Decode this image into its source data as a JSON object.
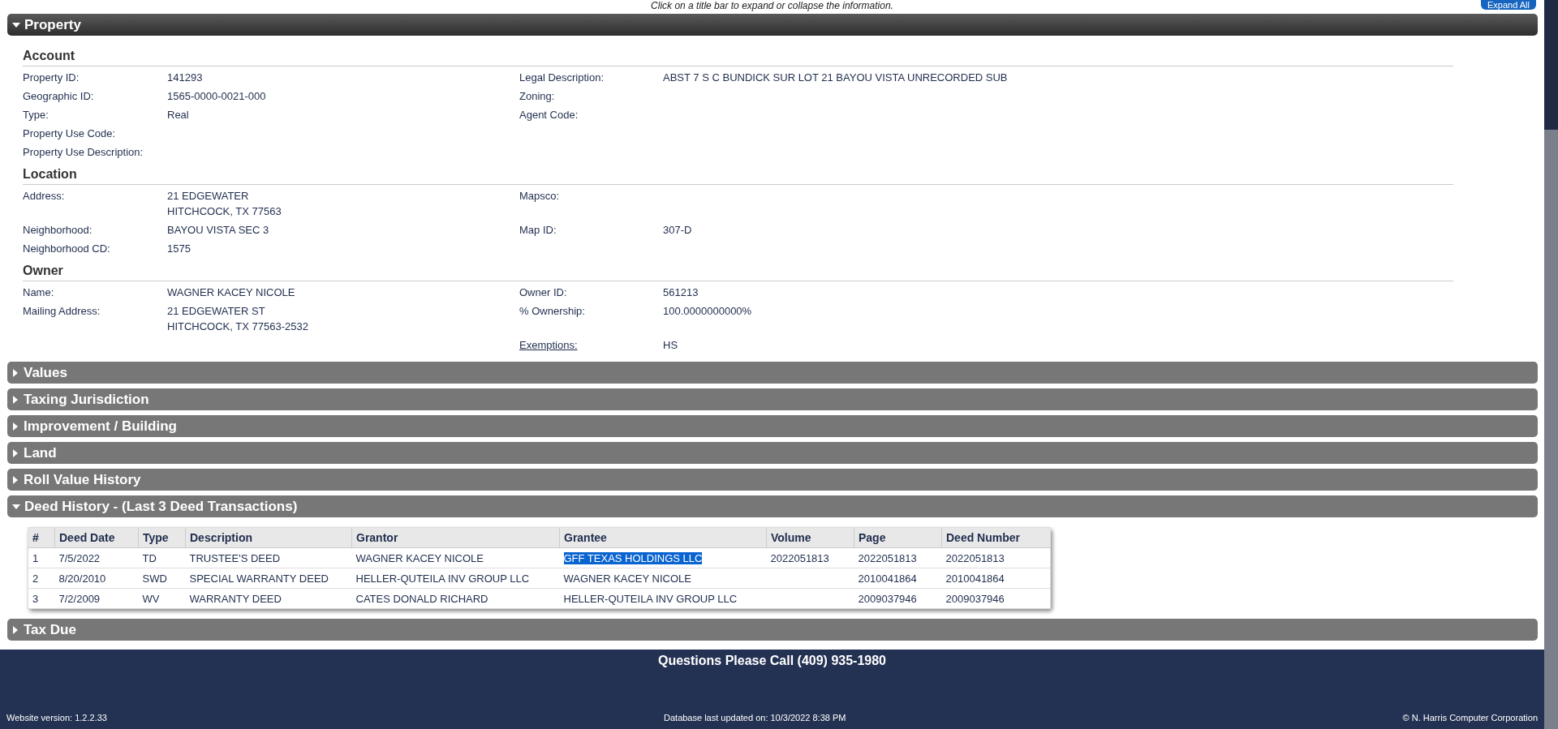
{
  "hint": "Click on a title bar to expand or collapse the information.",
  "expand_all_button": "Expand All",
  "sections": [
    {
      "title": "Property",
      "expanded": true,
      "active": true,
      "kind": "fields",
      "groups": [
        {
          "title": "Account",
          "rows": [
            {
              "left": {
                "label": "Property ID:",
                "lines": [
                  "141293"
                ]
              },
              "right": {
                "label": "Legal Description:",
                "lines": [
                  "ABST 7 S C BUNDICK SUR LOT 21 BAYOU VISTA UNRECORDED SUB"
                ]
              }
            },
            {
              "left": {
                "label": "Geographic ID:",
                "lines": [
                  "1565-0000-0021-000"
                ]
              },
              "right": {
                "label": "Zoning:"
              }
            },
            {
              "left": {
                "label": "Type:",
                "lines": [
                  "Real"
                ]
              },
              "right": {
                "label": "Agent Code:"
              }
            },
            {
              "left": {
                "label": "Property Use Code:"
              }
            },
            {
              "left": {
                "label": "Property Use Description:"
              }
            }
          ]
        },
        {
          "title": "Location",
          "rows": [
            {
              "left": {
                "label": "Address:",
                "lines": [
                  "21 EDGEWATER",
                  "HITCHCOCK, TX 77563"
                ]
              },
              "right": {
                "label": "Mapsco:"
              }
            },
            {
              "left": {
                "label": "Neighborhood:",
                "lines": [
                  "BAYOU VISTA SEC 3"
                ]
              },
              "right": {
                "label": "Map ID:",
                "lines": [
                  "307-D"
                ]
              }
            },
            {
              "left": {
                "label": "Neighborhood CD:",
                "lines": [
                  "1575"
                ]
              }
            }
          ]
        },
        {
          "title": "Owner",
          "rows": [
            {
              "left": {
                "label": "Name:",
                "lines": [
                  "WAGNER KACEY NICOLE"
                ]
              },
              "right": {
                "label": "Owner ID:",
                "lines": [
                  "561213"
                ]
              }
            },
            {
              "left": {
                "label": "Mailing Address:",
                "lines": [
                  "21 EDGEWATER ST",
                  "HITCHCOCK, TX 77563-2532"
                ]
              },
              "right": {
                "label": "% Ownership:",
                "lines": [
                  "100.0000000000%"
                ]
              }
            },
            {
              "right": {
                "label": "Exemptions:",
                "link": true,
                "lines": [
                  "HS"
                ]
              }
            }
          ]
        }
      ]
    },
    {
      "title": "Values",
      "expanded": false,
      "active": false
    },
    {
      "title": "Taxing Jurisdiction",
      "expanded": false,
      "active": false
    },
    {
      "title": "Improvement / Building",
      "expanded": false,
      "active": false
    },
    {
      "title": "Land",
      "expanded": false,
      "active": false
    },
    {
      "title": "Roll Value History",
      "expanded": false,
      "active": false
    },
    {
      "title": "Deed History - (Last 3 Deed Transactions)",
      "expanded": true,
      "active": false,
      "kind": "table",
      "table": {
        "columns": [
          "#",
          "Deed Date",
          "Type",
          "Description",
          "Grantor",
          "Grantee",
          "Volume",
          "Page",
          "Deed Number"
        ],
        "rows": [
          {
            "grantee_selected": true,
            "cells": [
              "1",
              "7/5/2022",
              "TD",
              "TRUSTEE'S DEED",
              "WAGNER KACEY NICOLE",
              "GFF TEXAS HOLDINGS LLC",
              "2022051813",
              "2022051813",
              "2022051813"
            ]
          },
          {
            "grantee_selected": false,
            "cells": [
              "2",
              "8/20/2010",
              "SWD",
              "SPECIAL WARRANTY DEED",
              "HELLER-QUTEILA INV GROUP LLC",
              "WAGNER KACEY NICOLE",
              null,
              "2010041864",
              "2010041864"
            ]
          },
          {
            "grantee_selected": false,
            "cells": [
              "3",
              "7/2/2009",
              "WV",
              "WARRANTY DEED",
              "CATES DONALD RICHARD",
              "HELLER-QUTEILA INV GROUP LLC",
              null,
              "2009037946",
              "2009037946"
            ]
          }
        ]
      }
    },
    {
      "title": "Tax Due",
      "expanded": false,
      "active": false
    }
  ],
  "footer": {
    "phone": "Questions Please Call (409) 935-1980",
    "version": "Website version: 1.2.2.33",
    "updated": "Database last updated on: 10/3/2022 8:38 PM",
    "copyright": "© N. Harris Computer Corporation"
  }
}
